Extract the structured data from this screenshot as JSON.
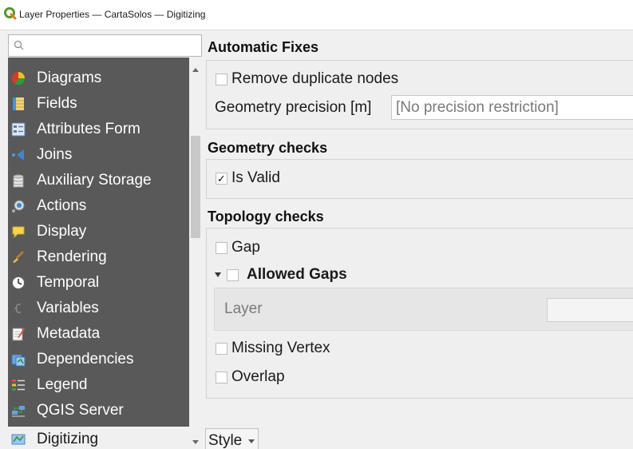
{
  "window": {
    "title": "Layer Properties — CartaSolos — Digitizing"
  },
  "search": {
    "placeholder": ""
  },
  "sidebar": {
    "items": [
      {
        "label": "Diagrams",
        "icon": "diagrams-icon"
      },
      {
        "label": "Fields",
        "icon": "fields-icon"
      },
      {
        "label": "Attributes Form",
        "icon": "attributes-form-icon"
      },
      {
        "label": "Joins",
        "icon": "joins-icon"
      },
      {
        "label": "Auxiliary Storage",
        "icon": "auxiliary-storage-icon"
      },
      {
        "label": "Actions",
        "icon": "actions-icon"
      },
      {
        "label": "Display",
        "icon": "display-icon"
      },
      {
        "label": "Rendering",
        "icon": "rendering-icon"
      },
      {
        "label": "Temporal",
        "icon": "temporal-icon"
      },
      {
        "label": "Variables",
        "icon": "variables-icon"
      },
      {
        "label": "Metadata",
        "icon": "metadata-icon"
      },
      {
        "label": "Dependencies",
        "icon": "dependencies-icon"
      },
      {
        "label": "Legend",
        "icon": "legend-icon"
      },
      {
        "label": "QGIS Server",
        "icon": "qgis-server-icon"
      },
      {
        "label": "Digitizing",
        "icon": "digitizing-icon",
        "selected": true
      }
    ]
  },
  "automatic_fixes": {
    "heading": "Automatic Fixes",
    "remove_duplicates_label": "Remove duplicate nodes",
    "remove_duplicates_checked": false,
    "precision_label": "Geometry precision [m]",
    "precision_placeholder": "[No precision restriction]"
  },
  "geometry_checks": {
    "heading": "Geometry checks",
    "is_valid_label": "Is Valid",
    "is_valid_checked": true,
    "check_mark": "✓"
  },
  "topology_checks": {
    "heading": "Topology checks",
    "gap_label": "Gap",
    "gap_checked": false,
    "allowed_gaps_label": "Allowed Gaps",
    "allowed_gaps_checked": false,
    "layer_label": "Layer",
    "missing_vertex_label": "Missing Vertex",
    "missing_vertex_checked": false,
    "overlap_label": "Overlap",
    "overlap_checked": false
  },
  "footer": {
    "style_label": "Style"
  },
  "colors": {
    "sidebar_bg": "#595959",
    "sidebar_selected_bg": "#f0f0f0",
    "qgis_green": "#589632"
  }
}
